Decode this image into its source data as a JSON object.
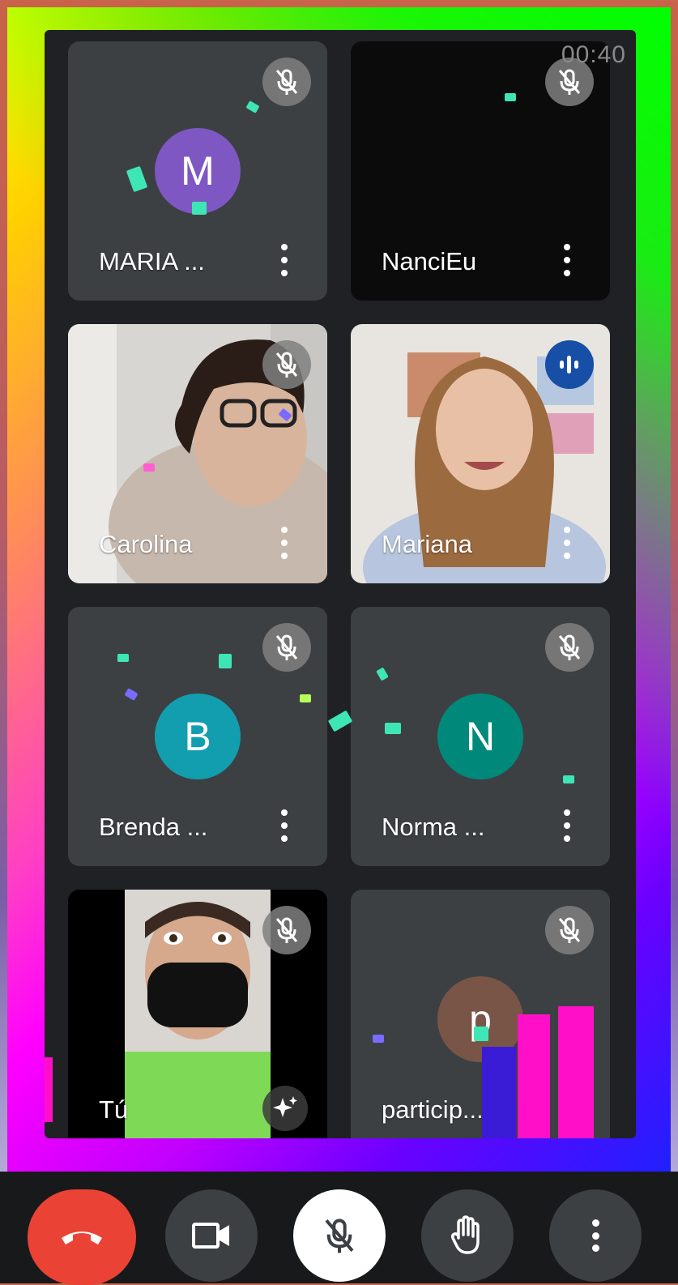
{
  "call": {
    "timer": "00:40"
  },
  "participants": [
    {
      "name": "MARIA ...",
      "initial": "M",
      "avatar_color": "#7e57c2",
      "muted": true,
      "type": "avatar",
      "tile_bg": "#3c4043"
    },
    {
      "name": "NanciEu",
      "initial": "",
      "avatar_color": "",
      "muted": true,
      "type": "blank",
      "tile_bg": "#0b0b0c"
    },
    {
      "name": "Carolina",
      "muted": true,
      "type": "video"
    },
    {
      "name": "Mariana",
      "muted": false,
      "speaking": true,
      "type": "video"
    },
    {
      "name": "Brenda ...",
      "initial": "B",
      "avatar_color": "#129eaf",
      "muted": true,
      "type": "avatar"
    },
    {
      "name": "Norma ...",
      "initial": "N",
      "avatar_color": "#00897b",
      "muted": true,
      "type": "avatar"
    },
    {
      "name": "Tú",
      "muted": true,
      "type": "self-video"
    },
    {
      "name": "particip... á...",
      "initial": "p",
      "avatar_color": "#795548",
      "muted": true,
      "type": "avatar"
    }
  ],
  "icons": {
    "mute": "mic-off-icon",
    "speaking": "audio-level-icon",
    "more": "more-vert-icon",
    "effects": "sparkle-icon",
    "end_call": "call-end-icon",
    "camera": "videocam-icon",
    "microphone": "mic-off-icon",
    "raise_hand": "hand-icon",
    "more_options": "more-vert-icon"
  },
  "colors": {
    "end_call": "#ea4335",
    "tile": "#3c4043",
    "stage": "#202124",
    "speaking": "#174ea6"
  }
}
